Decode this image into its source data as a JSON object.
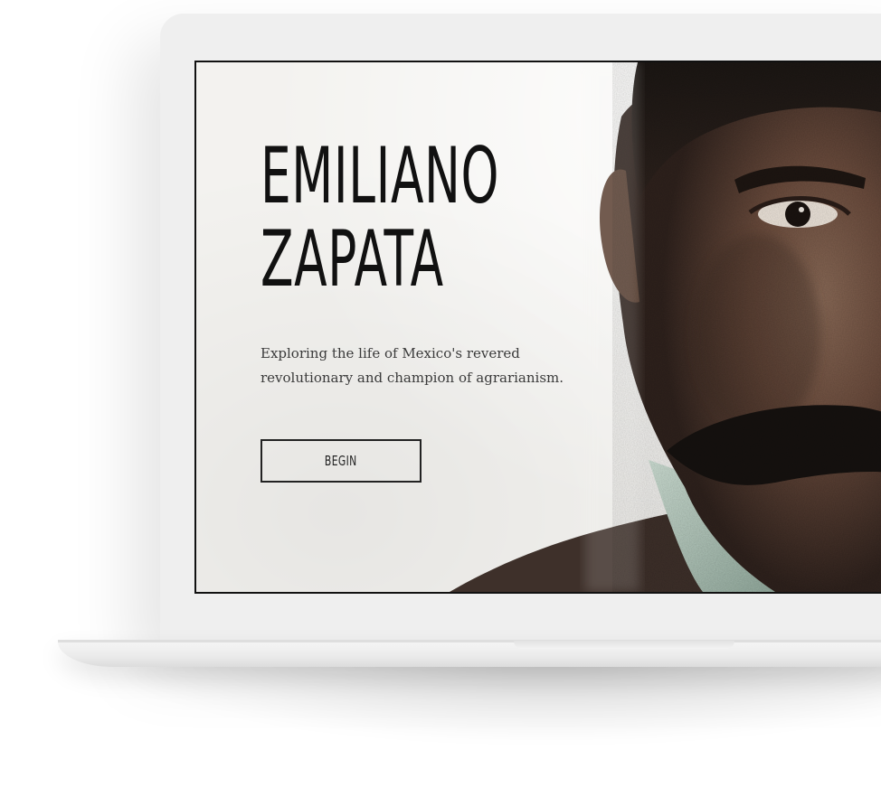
{
  "hero": {
    "title_line1": "EMILIANO",
    "title_line2": "ZAPATA",
    "tagline": "Exploring the life of Mexico's revered revolutionary and champion of agrarianism.",
    "button_label": "BEGIN"
  },
  "colors": {
    "background": "#ffffff",
    "laptop_body": "#efefef",
    "screen_bezel": "#111111",
    "screen_paper": "#f3f2ef",
    "title_text": "#111111",
    "body_text": "#3a3a3a",
    "button_border": "#222222"
  },
  "icons": {
    "portrait": "portrait-photo"
  }
}
